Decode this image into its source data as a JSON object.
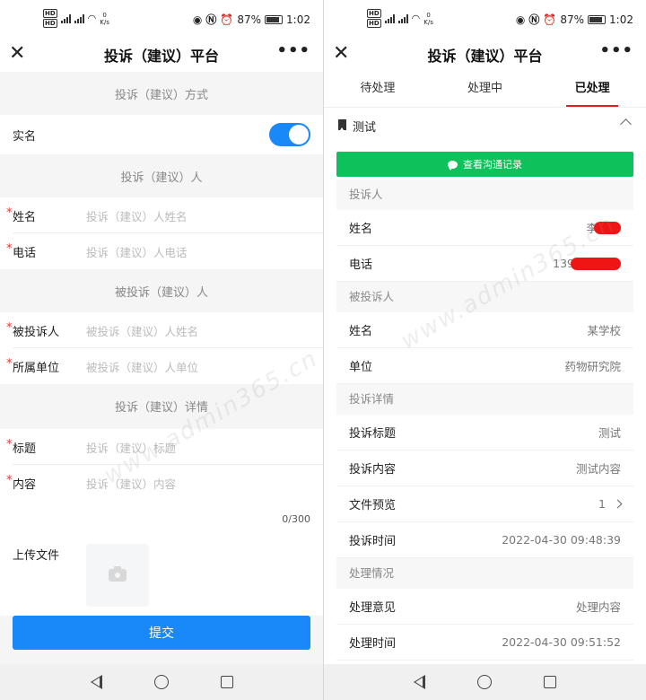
{
  "status_bar": {
    "battery": "87%",
    "time": "1:02",
    "speed_value": "0",
    "speed_unit": "K/s"
  },
  "app": {
    "title": "投诉（建议）平台",
    "close_glyph": "✕",
    "more_glyph": "•••"
  },
  "form": {
    "section_method": "投诉（建议）方式",
    "real_name_label": "实名",
    "real_name_on": true,
    "section_complainant": "投诉（建议）人",
    "name_label": "姓名",
    "name_placeholder": "投诉（建议）人姓名",
    "phone_label": "电话",
    "phone_placeholder": "投诉（建议）人电话",
    "section_respondent": "被投诉（建议）人",
    "respondent_label": "被投诉人",
    "respondent_placeholder": "被投诉（建议）人姓名",
    "unit_label": "所属单位",
    "unit_placeholder": "被投诉（建议）人单位",
    "section_detail": "投诉（建议）详情",
    "subject_label": "标题",
    "subject_placeholder": "投诉（建议）标题",
    "content_label": "内容",
    "content_placeholder": "投诉（建议）内容",
    "char_count": "0/300",
    "upload_label": "上传文件",
    "submit_label": "提交"
  },
  "tabs": [
    {
      "label": "待处理",
      "active": false
    },
    {
      "label": "处理中",
      "active": false
    },
    {
      "label": "已处理",
      "active": true
    }
  ],
  "record": {
    "title": "测试",
    "comm_button": "查看沟通记录",
    "group_complainant": "投诉人",
    "name_label": "姓名",
    "name_value": "李",
    "phone_label": "电话",
    "phone_value": "139",
    "group_respondent": "被投诉人",
    "resp_name_label": "姓名",
    "resp_name_value": "某学校",
    "resp_unit_label": "单位",
    "resp_unit_value": "药物研究院",
    "group_detail": "投诉详情",
    "subject_label": "投诉标题",
    "subject_value": "测试",
    "content_label": "投诉内容",
    "content_value": "测试内容",
    "file_label": "文件预览",
    "file_value": "1",
    "time_label": "投诉时间",
    "time_value": "2022-04-30 09:48:39",
    "group_handling": "处理情况",
    "opinion_label": "处理意见",
    "opinion_value": "处理内容",
    "handle_time_label": "处理时间",
    "handle_time_value": "2022-04-30 09:51:52"
  },
  "watermark_text": "www.admin365.cn",
  "colors": {
    "primary_blue": "#1989fa",
    "wechat_green": "#0fc15b",
    "tab_indicator": "#e02020",
    "required_star": "#e23a3a",
    "redaction": "#f01515"
  }
}
